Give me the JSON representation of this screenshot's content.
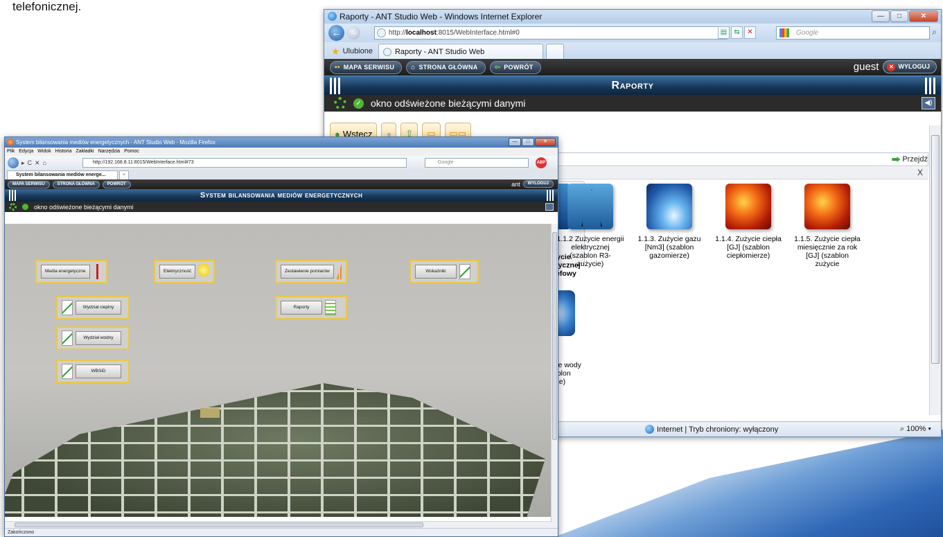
{
  "document": {
    "visible_text": "telefonicznej."
  },
  "ie_window": {
    "title": "Raporty - ANT Studio Web - Windows Internet Explorer",
    "url_prefix": "http://",
    "url_host": "localhost",
    "url_rest": ":8015/WebInterface.html#0",
    "search_placeholder": "Google",
    "favorites_label": "Ulubione",
    "tab_label": "Raporty - ANT Studio Web",
    "nav": {
      "site_map": "MAPA SERWISU",
      "home": "STRONA GŁÓWNA",
      "back": "POWRÓT"
    },
    "user": "guest",
    "logout": "WYLOGUJ",
    "page_title": "Raporty",
    "status_message": "okno odświeżone bieżącymi danymi",
    "toolstrip_back": "Wstecz",
    "go_label": "Przejdź",
    "close_label": "X",
    "partial_selected_label": "życie\ntrycznej\nrefowy",
    "partial_water_label": "cie wody\nablon\nrze)",
    "reports": [
      {
        "label": "1.1.2 Zużycie energii elektrycznej (szablon R3-zużycie)",
        "icon": "power-tower-icon"
      },
      {
        "label": "1.1.3. Zużycie gazu [Nm3] (szablon gazomierze)",
        "icon": "gas-flame-icon"
      },
      {
        "label": "1.1.4. Zużycie ciepła [GJ] (szablon ciepłomierze)",
        "icon": "fire-icon"
      },
      {
        "label": "1.1.5. Zużycie ciepła miesięcznie za rok [GJ] (szablon zużycie",
        "icon": "fire-icon"
      }
    ],
    "status_zone": "Internet | Tryb chroniony: wyłączony",
    "zoom": "100%"
  },
  "ff_window": {
    "title": "System bilansowania mediów energetycznych - ANT Studio Web - Mozilla Firefox",
    "menu": [
      "Plik",
      "Edycja",
      "Widok",
      "Historia",
      "Zakładki",
      "Narzędzia",
      "Pomoc"
    ],
    "url": "http://192.168.8.11:8015/WebInterface.html#73",
    "search_placeholder": "Google",
    "tab_label": "System bilansowania mediów energe...",
    "new_tab": "+",
    "nav": {
      "site_map": "MAPA SERWISU",
      "home": "STRONA GŁÓWNA",
      "back": "POWRÓT"
    },
    "user": "ant",
    "logout": "WYLOGUJ",
    "page_title": "System bilansowania mediów energetycznych",
    "status_message": "okno odświeżone bieżącymi danymi",
    "tiles": {
      "media": "Media energetyczne",
      "electricity": "Elektryczność",
      "measurements": "Zestawienie pomiarów",
      "indicators": "Wskaźniki",
      "reports": "Raporty",
      "heat": "Wydział cieplny",
      "water": "Wydział wodny",
      "wbsid": "WBSiD"
    },
    "statusbar": "Zakończono"
  }
}
